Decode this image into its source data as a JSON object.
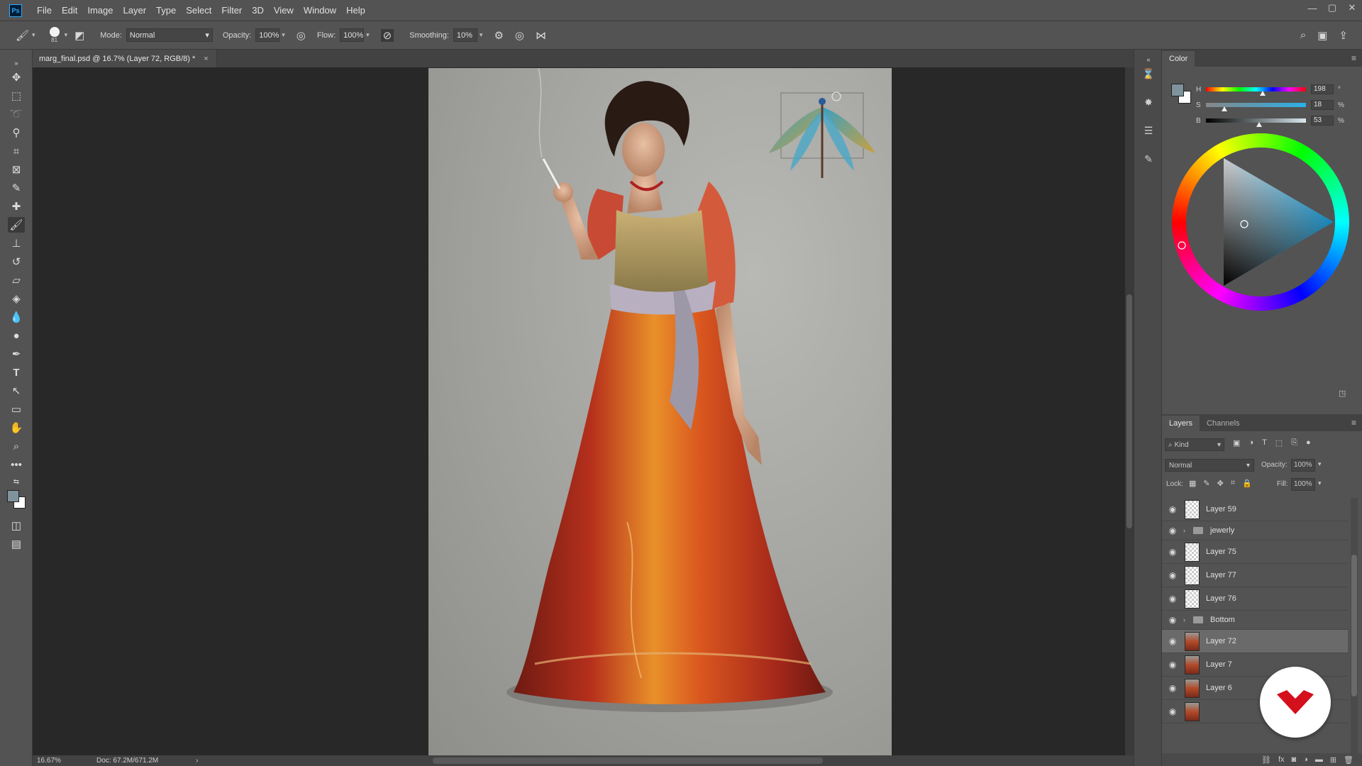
{
  "app": {
    "logo": "Ps",
    "menu": [
      "File",
      "Edit",
      "Image",
      "Layer",
      "Type",
      "Select",
      "Filter",
      "3D",
      "View",
      "Window",
      "Help"
    ],
    "window_controls": [
      "—",
      "▢",
      "✕"
    ]
  },
  "options": {
    "brush_size": "81",
    "mode_label": "Mode:",
    "mode_value": "Normal",
    "opacity_label": "Opacity:",
    "opacity_value": "100%",
    "flow_label": "Flow:",
    "flow_value": "100%",
    "smoothing_label": "Smoothing:",
    "smoothing_value": "10%"
  },
  "document": {
    "tab_title": "marg_final.psd @ 16.7% (Layer 72, RGB/8) *",
    "tab_close": "×",
    "zoom": "16.67%",
    "doc_size": "Doc: 67.2M/671.2M",
    "status_arrow": "›"
  },
  "color_panel": {
    "tab": "Color",
    "h_label": "H",
    "h_value": "198",
    "h_unit": "°",
    "h_level": 0.55,
    "s_label": "S",
    "s_value": "18",
    "s_unit": "%",
    "s_level": 0.18,
    "b_label": "B",
    "b_value": "53",
    "b_unit": "%",
    "b_level": 0.53,
    "foreground": "#7f939c",
    "background": "#ffffff"
  },
  "layers_panel": {
    "tabs": [
      "Layers",
      "Channels"
    ],
    "filter_kind": "Kind",
    "blend_mode": "Normal",
    "opacity_label": "Opacity:",
    "opacity_value": "100%",
    "lock_label": "Lock:",
    "fill_label": "Fill:",
    "fill_value": "100%",
    "layers": [
      {
        "name": "Layer 59",
        "type": "layer",
        "thumb": "empty"
      },
      {
        "name": "jewerly",
        "type": "group"
      },
      {
        "name": "Layer 75",
        "type": "layer",
        "thumb": "empty"
      },
      {
        "name": "Layer 77",
        "type": "layer",
        "thumb": "empty"
      },
      {
        "name": "Layer 76",
        "type": "layer",
        "thumb": "empty"
      },
      {
        "name": "Bottom",
        "type": "group"
      },
      {
        "name": "Layer 72",
        "type": "layer",
        "thumb": "art",
        "selected": true
      },
      {
        "name": "Layer 7",
        "type": "layer",
        "thumb": "art"
      },
      {
        "name": "Layer 6",
        "type": "layer",
        "thumb": "art"
      }
    ]
  },
  "colors": {
    "accent": "#31a8ff",
    "badge_red": "#d4101c"
  }
}
